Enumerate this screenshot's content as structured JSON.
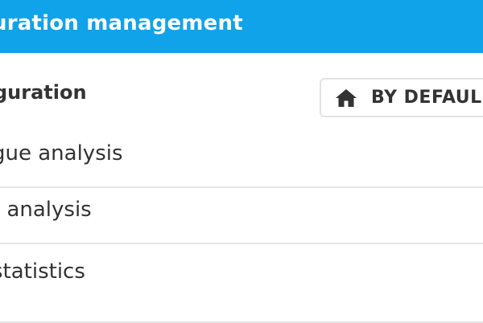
{
  "header": {
    "title": "uration management"
  },
  "config": {
    "title": "guration",
    "default_button_label": "BY DEFAUL"
  },
  "list": {
    "items": [
      {
        "label": "gue analysis"
      },
      {
        "label": "t analysis"
      },
      {
        "label": "statistics"
      }
    ]
  },
  "colors": {
    "header_bg": "#10a3ea",
    "text": "#333333",
    "divider": "#e6e6e6"
  },
  "icons": {
    "default_button_icon": "home-icon"
  }
}
